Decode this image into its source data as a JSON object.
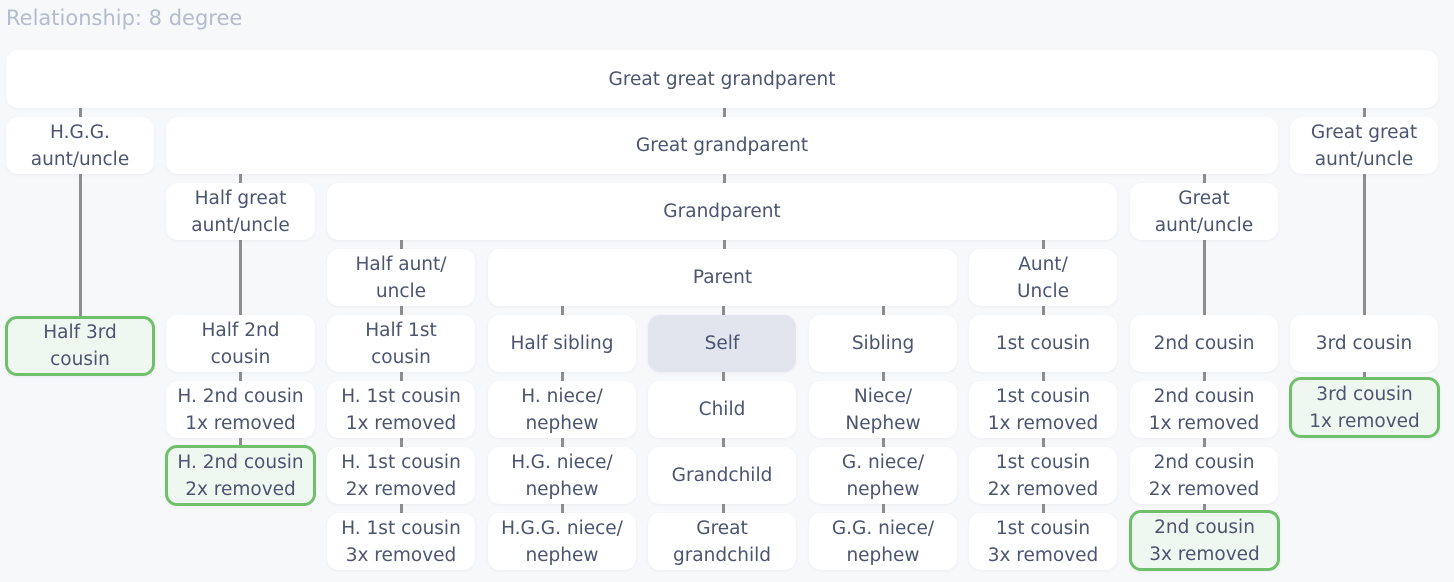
{
  "title": "Relationship: 8 degree",
  "colors": {
    "background": "#f7f8fa",
    "node": "#ffffff",
    "self": "#e2e5ee",
    "highlight_border": "#6fbf6b",
    "highlight_fill": "#eff8f0",
    "text": "#4b5470",
    "title": "#b3bccd",
    "connector": "#8e8e8e"
  },
  "nodes": {
    "ggp": "Great great grandparent",
    "hgg_au": "H.G.G.\naunt/uncle",
    "gp2": "Great grandparent",
    "gg_au": "Great great\naunt/uncle",
    "h_g_au": "Half great\naunt/uncle",
    "grandparent": "Grandparent",
    "g_au": "Great\naunt/uncle",
    "h_au": "Half aunt/\nuncle",
    "parent": "Parent",
    "au": "Aunt/\nUncle",
    "h3c": "Half 3rd\ncousin",
    "h2c": "Half 2nd\ncousin",
    "h1c": "Half 1st\ncousin",
    "hsib": "Half sibling",
    "self": "Self",
    "sib": "Sibling",
    "c1": "1st cousin",
    "c2": "2nd cousin",
    "c3": "3rd cousin",
    "h2c1": "H. 2nd cousin\n1x removed",
    "h1c1": "H. 1st cousin\n1x removed",
    "hnn": "H. niece/\nnephew",
    "child": "Child",
    "nn": "Niece/\nNephew",
    "c1r1": "1st cousin\n1x removed",
    "c2r1": "2nd cousin\n1x removed",
    "c3r1": "3rd cousin\n1x removed",
    "h2c2": "H. 2nd cousin\n2x removed",
    "h1c2": "H. 1st cousin\n2x removed",
    "hgnn": "H.G. niece/\nnephew",
    "grandchild": "Grandchild",
    "gnn": "G. niece/\nnephew",
    "c1r2": "1st cousin\n2x removed",
    "c2r2": "2nd cousin\n2x removed",
    "h1c3": "H. 1st cousin\n3x removed",
    "hggnn": "H.G.G. niece/\nnephew",
    "ggchild": "Great\ngrandchild",
    "ggnn": "G.G. niece/\nnephew",
    "c1r3": "1st cousin\n3x removed",
    "c2r3": "2nd cousin\n3x removed"
  },
  "highlighted": [
    "h3c",
    "h2c2",
    "c3r1",
    "c2r3"
  ]
}
